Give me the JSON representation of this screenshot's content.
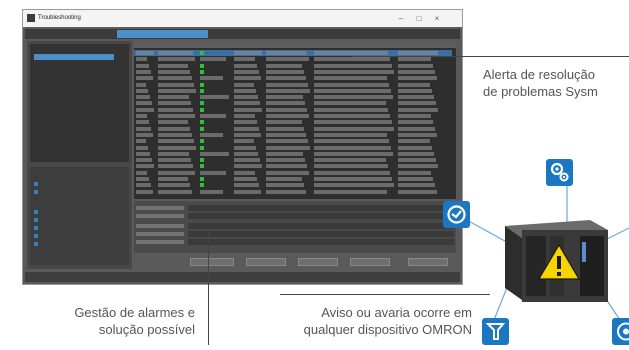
{
  "window": {
    "title": "Troubleshooting",
    "tabs": [
      "",
      "",
      "",
      ""
    ]
  },
  "callouts": {
    "top_right": [
      "Alerta de resolução",
      "de problemas Sysm"
    ],
    "bottom_left": [
      "Gestão de alarmes e",
      "solução possível"
    ],
    "bottom_center": [
      "Aviso ou avaria ocorre em",
      "qualquer dispositivo OMRON"
    ]
  },
  "icons": {
    "gears": "gears-icon",
    "network": "network-icon",
    "robot": "robot-arm-icon",
    "vision": "vision-icon",
    "warning": "warning-triangle-icon"
  },
  "colors": {
    "accent": "#1c77c3",
    "warning": "#f5d400"
  }
}
